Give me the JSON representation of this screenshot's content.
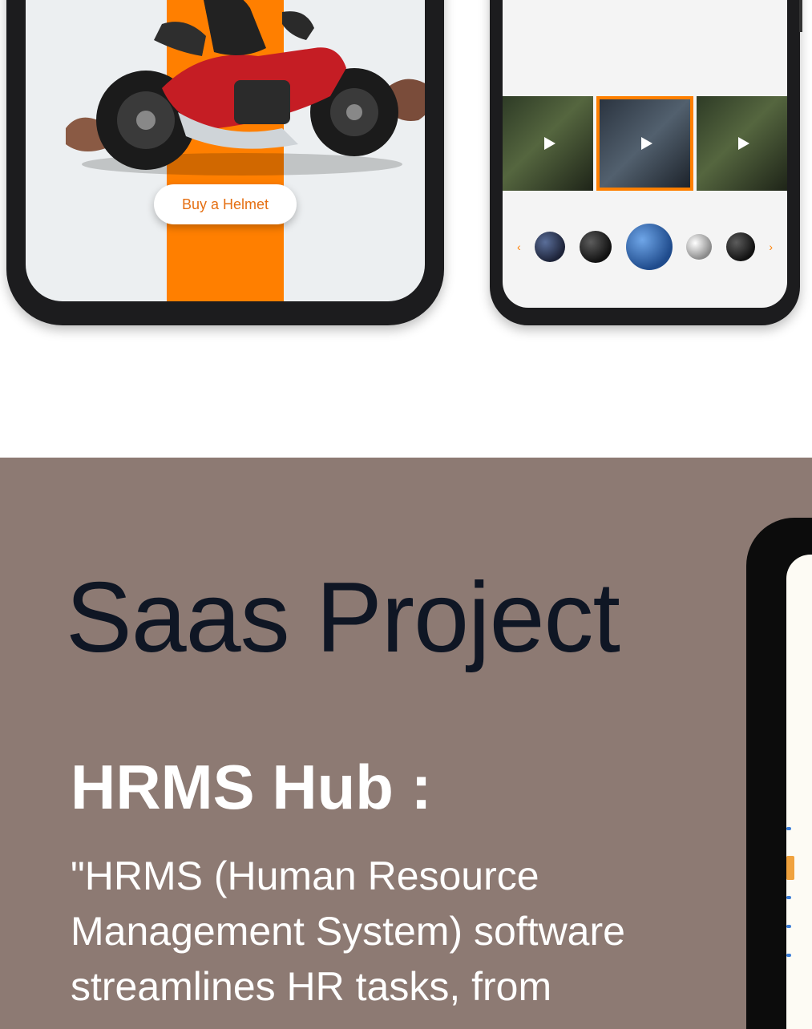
{
  "top_section": {
    "helmet_app": {
      "cta_label": "Buy a Helmet"
    },
    "product_app": {
      "about_text": "",
      "read_more": "",
      "videos": [
        {
          "icon": "play-icon",
          "selected": false
        },
        {
          "icon": "play-icon",
          "selected": true
        },
        {
          "icon": "play-icon",
          "selected": false
        }
      ],
      "helmet_icons": [
        "helmet-icon",
        "helmet-icon",
        "helmet-icon",
        "helmet-icon",
        "helmet-icon"
      ]
    }
  },
  "saas_section": {
    "heading": "Saas Project",
    "project_name": "HRMS Hub :",
    "description": "\"HRMS (Human Resource Management System) software streamlines HR tasks, from",
    "background_color": "#8d7a73",
    "heading_color": "#0f1624"
  },
  "colors": {
    "accent": "#ff7f00"
  }
}
